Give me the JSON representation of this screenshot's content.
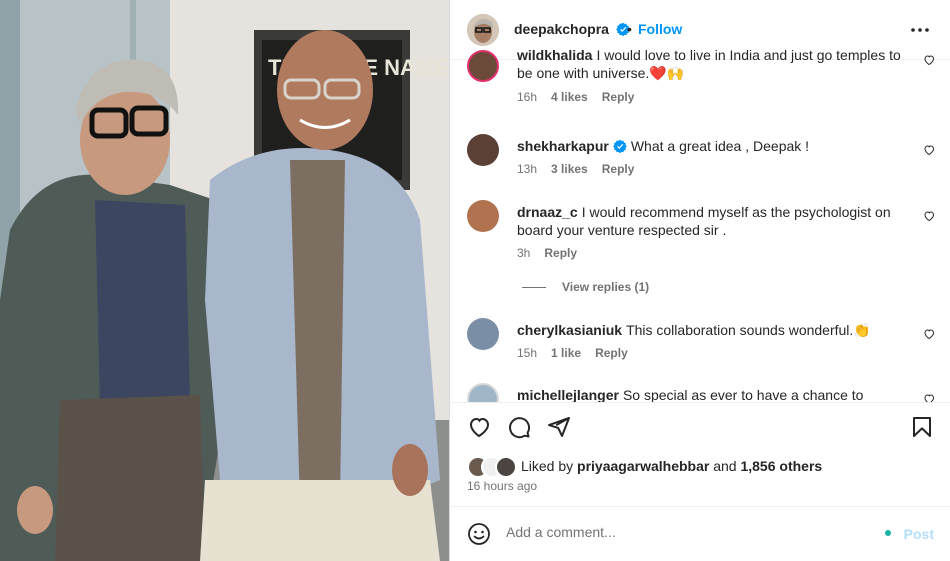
{
  "post": {
    "author": "deepakchopra",
    "author_verified": true,
    "follow_label": "Follow",
    "separator": "•",
    "more_icon": "more-horizontal-icon",
    "image_poster_text": "THEY ARE NAME THE"
  },
  "comments": [
    {
      "username": "wildkhalida",
      "text": "I would love to live in India and just go temples to be one with universe.❤️🙌",
      "time": "16h",
      "likes": "4 likes",
      "reply": "Reply",
      "avatar_color": "#6b4a3a"
    },
    {
      "username": "shekharkapur",
      "verified": true,
      "text": "What a great idea , Deepak !",
      "time": "13h",
      "likes": "3 likes",
      "reply": "Reply",
      "avatar_color": "#5a4035"
    },
    {
      "username": "drnaaz_c",
      "text": "I would recommend myself as the psychologist on board your venture respected sir .",
      "time": "3h",
      "reply": "Reply",
      "avatar_color": "#b0724f"
    },
    {
      "username": "cherylkasianiuk",
      "text": "This collaboration sounds wonderful.👏",
      "time": "15h",
      "likes": "1 like",
      "reply": "Reply",
      "avatar_color": "#7a8fa5"
    },
    {
      "username": "michellejlanger",
      "text": "So special as ever to have a chance to",
      "avatar_color": "#9fb6c9"
    }
  ],
  "view_replies": "View replies (1)",
  "actions": {
    "like_icon": "heart-icon",
    "comment_icon": "comment-icon",
    "share_icon": "share-icon",
    "save_icon": "bookmark-icon"
  },
  "likes": {
    "prefix": "Liked by",
    "user": "priyaagarwalhebbar",
    "and": "and",
    "count": "1,856 others"
  },
  "timestamp": "16 hours ago",
  "add_comment": {
    "placeholder": "Add a comment...",
    "post_label": "Post"
  },
  "colors": {
    "link_blue": "#0095f6",
    "post_disabled": "#b2dffc",
    "secondary_text": "#737373",
    "heart_red": "#ed4956"
  }
}
